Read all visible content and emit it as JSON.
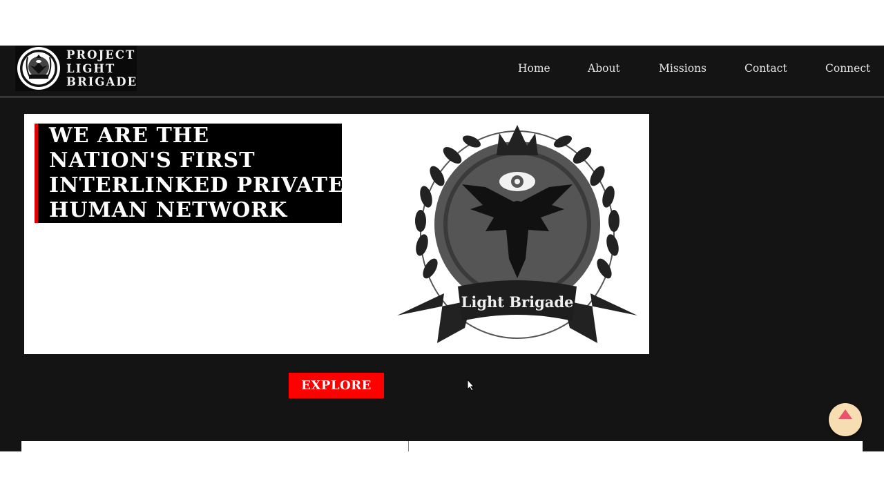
{
  "brand": {
    "lines": [
      "PROJECT",
      "LIGHT",
      "BRIGADE"
    ],
    "logo_icon": "light-brigade-emblem"
  },
  "nav": {
    "items": [
      {
        "label": "Home"
      },
      {
        "label": "About"
      },
      {
        "label": "Missions"
      },
      {
        "label": "Contact"
      },
      {
        "label": "Connect"
      }
    ]
  },
  "hero": {
    "headline_lines": [
      "WE ARE THE",
      "NATION'S FIRST",
      "INTERLINKED PRIVATE",
      "HUMAN NETWORK"
    ],
    "emblem_banner": "Light Brigade",
    "emblem_icon": "phoenix-eye-crown-emblem"
  },
  "cta": {
    "explore_label": "EXPLORE"
  },
  "scroll_top": {
    "icon": "arrow-up-icon"
  },
  "colors": {
    "dark_bg": "#141414",
    "accent_red": "#ff0000",
    "scroll_button": "#f7ddb2",
    "scroll_arrow": "#e8536a"
  }
}
